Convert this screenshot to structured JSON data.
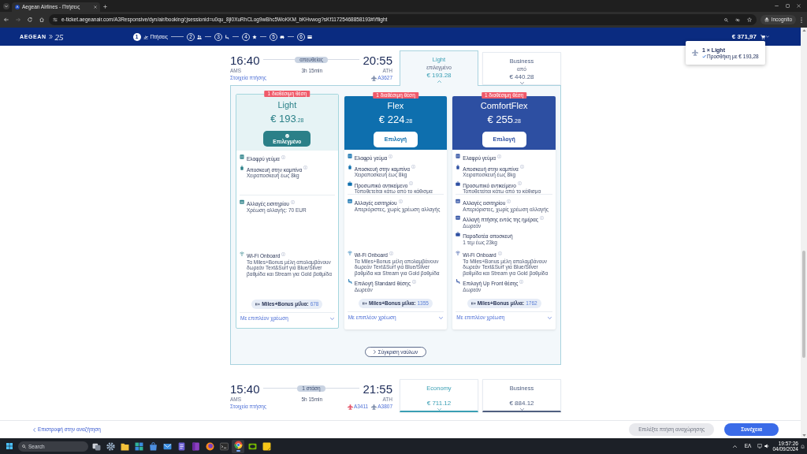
{
  "browser": {
    "tab_title": "Aegean Airlines - Πτήσεις",
    "url": "e-ticket.aegeanair.com/A3Responsive/dyn/air/booking/;jsessionid=u0qu_8jl0XuRhCLog9wBhc5WoKKM_bKHvwog?sKf11725468858193#!/flight",
    "profile": "Incognito"
  },
  "header": {
    "logo": "AEGEAN",
    "anniversary": "25",
    "steps": [
      {
        "kind": "flights",
        "number": "1",
        "label": "Πτήσεις",
        "selected": true
      },
      {
        "kind": "passengers",
        "number": "2",
        "selected": false
      },
      {
        "kind": "seats",
        "number": "3",
        "selected": false
      },
      {
        "kind": "extras",
        "number": "4",
        "selected": false
      },
      {
        "kind": "transport",
        "number": "5",
        "selected": false
      },
      {
        "kind": "payment",
        "number": "6",
        "selected": false
      }
    ],
    "total": "€ 371,97"
  },
  "cart_popup": {
    "title": "1 × Light",
    "note": "Προσθήκη με € 193,28"
  },
  "flights": [
    {
      "departure_time": "16:40",
      "departure_airport": "AMS",
      "details_link": "Στοιχεία πτήσης",
      "stops": "απευθείας",
      "duration": "3h 15min",
      "arrival_time": "20:55",
      "arrival_airport": "ATH",
      "flight_numbers": [
        {
          "number": "A3627",
          "color": "#7a8aa8"
        }
      ],
      "cabins": [
        {
          "kind": "economy",
          "name": "Light",
          "note": "επιλεγμένο",
          "price": "€ 193.28",
          "selected": true
        },
        {
          "kind": "business",
          "name": "Business",
          "note": "από",
          "price": "€ 440.28",
          "selected": false
        }
      ],
      "fare_panel": {
        "fares": [
          {
            "name": "Light",
            "price": "€ 193",
            "decimals": ".28",
            "badge": "1 διαθέσιμη θέση",
            "button": "Επιλεγμένο",
            "selected": true,
            "color": "#2b8088",
            "groups": [
              {
                "features": [
                  {
                    "kind": "meal",
                    "title": "Ελαφρύ γεύμα",
                    "info": true
                  },
                  {
                    "kind": "cabin-bag",
                    "title": "Αποσκευή στην καμπίνα",
                    "detail": "Χειραποσκευή έως 8kg",
                    "info": true
                  }
                ]
              },
              {
                "features": [
                  {
                    "kind": "change",
                    "title": "Αλλαγές εισιτηρίου",
                    "detail": "Χρέωση αλλαγής: 70 EUR",
                    "info": true
                  }
                ]
              },
              {
                "features": [
                  {
                    "kind": "wifi",
                    "title": "Wi-Fi Onboard",
                    "detail": "Τα Miles+Bonus μέλη απολαμβάνουν δωρεάν Text&Surf για Blue/Silver βαθμίδα και Stream για Gold βαθμίδα",
                    "info": true
                  }
                ]
              }
            ],
            "miles_label": "Miles+Bonus μίλια:",
            "miles": "678",
            "more": "Με επιπλέον χρέωση"
          },
          {
            "name": "Flex",
            "price": "€ 224",
            "decimals": ".28",
            "badge": "1 διαθέσιμη θέση",
            "button": "Επιλογή",
            "selected": false,
            "color": "#0e6fae",
            "groups": [
              {
                "features": [
                  {
                    "kind": "meal",
                    "title": "Ελαφρύ γεύμα",
                    "info": true
                  },
                  {
                    "kind": "cabin-bag",
                    "title": "Αποσκευή στην καμπίνα",
                    "detail": "Χειραποσκευή έως 8kg",
                    "info": true
                  },
                  {
                    "kind": "personal-item",
                    "title": "Προσωπικό αντικείμενο",
                    "detail": "Τοποθετείται κάτω από το κάθισμα",
                    "info": true
                  }
                ]
              },
              {
                "features": [
                  {
                    "kind": "change",
                    "title": "Αλλαγές εισιτηρίου",
                    "detail": "Απεριόριστες, χωρίς χρέωση αλλαγής",
                    "info": true
                  }
                ]
              },
              {
                "features": [
                  {
                    "kind": "wifi",
                    "title": "Wi-Fi Onboard",
                    "detail": "Τα Miles+Bonus μέλη απολαμβάνουν δωρεάν Text&Surf για Blue/Silver βαθμίδα και Stream για Gold βαθμίδα",
                    "info": true
                  },
                  {
                    "kind": "seat",
                    "title": "Επιλογή Standard θέσης",
                    "detail": "Δωρεάν",
                    "info": true
                  }
                ]
              }
            ],
            "miles_label": "Miles+Bonus μίλια:",
            "miles": "1355",
            "more": "Με επιπλέον χρέωση"
          },
          {
            "name": "ComfortFlex",
            "price": "€ 255",
            "decimals": ".28",
            "badge": "1 διαθέσιμη θέση",
            "button": "Επιλογή",
            "selected": false,
            "color": "#2d4fa2",
            "groups": [
              {
                "features": [
                  {
                    "kind": "meal",
                    "title": "Ελαφρύ γεύμα",
                    "info": true
                  },
                  {
                    "kind": "cabin-bag",
                    "title": "Αποσκευή στην καμπίνα",
                    "detail": "Χειραποσκευή έως 8kg",
                    "info": true
                  },
                  {
                    "kind": "personal-item",
                    "title": "Προσωπικό αντικείμενο",
                    "detail": "Τοποθετείται κάτω από το κάθισμα",
                    "info": true
                  }
                ]
              },
              {
                "features": [
                  {
                    "kind": "change",
                    "title": "Αλλαγές εισιτηρίου",
                    "detail": "Απεριόριστες, χωρίς χρέωση αλλαγής",
                    "info": true
                  },
                  {
                    "kind": "same-day-change",
                    "title": "Αλλαγή πτήσης εντός της ημέρας",
                    "detail": "Δωρεάν",
                    "info": true
                  },
                  {
                    "kind": "checked-bag",
                    "title": "Παραδοτέα αποσκευή",
                    "detail": "1 τεμ έως 23kg",
                    "info": false
                  }
                ]
              },
              {
                "features": [
                  {
                    "kind": "wifi",
                    "title": "Wi-Fi Onboard",
                    "detail": "Τα Miles+Bonus μέλη απολαμβάνουν δωρεάν Text&Surf για Blue/Silver βαθμίδα και Stream για Gold βαθμίδα",
                    "info": true
                  },
                  {
                    "kind": "seat",
                    "title": "Επιλογή Up Front θέσης",
                    "detail": "Δωρεάν",
                    "info": true
                  }
                ]
              }
            ],
            "miles_label": "Miles+Bonus μίλια:",
            "miles": "1762",
            "more": "Με επιπλέον χρέωση"
          }
        ],
        "compare_button": "Σύγκριση ναύλων"
      }
    },
    {
      "departure_time": "15:40",
      "departure_airport": "AMS",
      "details_link": "Στοιχεία πτήσης",
      "stops": "1 στάση",
      "duration": "5h 15min",
      "arrival_time": "21:55",
      "arrival_airport": "ATH",
      "flight_numbers": [
        {
          "number": "A3411",
          "color": "#e5566a"
        },
        {
          "number": "A3807",
          "color": "#7a8aa8"
        }
      ],
      "cabins": [
        {
          "kind": "economy",
          "name": "Economy",
          "price": "€ 711.12",
          "selected": false
        },
        {
          "kind": "business",
          "name": "Business",
          "price": "€ 884.12",
          "selected": false
        }
      ]
    }
  ],
  "footer": {
    "back_link": "Επιστροφή στην αναζήτηση",
    "buttons": [
      {
        "label": "Επιλέξτε πτήση αναχώρησης",
        "disabled": true
      },
      {
        "label": "Συνέχεια",
        "disabled": false
      }
    ]
  },
  "taskbar": {
    "search_placeholder": "Search",
    "apps": [
      {
        "kind": "task-view",
        "selected": false
      },
      {
        "kind": "settings",
        "selected": false
      },
      {
        "kind": "folder",
        "selected": false
      },
      {
        "kind": "tiles",
        "selected": false
      },
      {
        "kind": "store",
        "selected": false
      },
      {
        "kind": "mail",
        "selected": false
      },
      {
        "kind": "document",
        "selected": false
      },
      {
        "kind": "notebook",
        "selected": false
      },
      {
        "kind": "orb-browser",
        "selected": false
      },
      {
        "kind": "terminal",
        "selected": false
      },
      {
        "kind": "ring-browser",
        "selected": true
      },
      {
        "kind": "graphics",
        "selected": false
      },
      {
        "kind": "note",
        "selected": false
      }
    ],
    "language": "ΕΛ",
    "time": "19:57:26",
    "date": "04/09/2024"
  }
}
